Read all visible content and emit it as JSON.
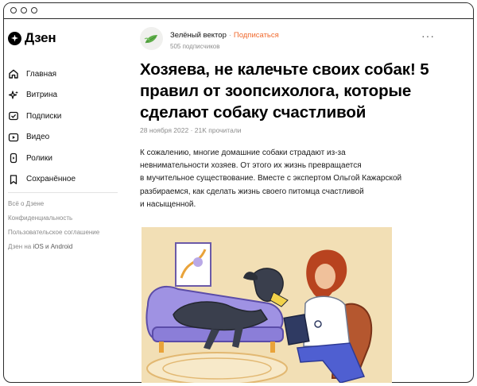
{
  "app": {
    "logo_text": "Дзен"
  },
  "sidebar": {
    "items": [
      {
        "label": "Главная",
        "icon": "home-icon"
      },
      {
        "label": "Витрина",
        "icon": "sparkle-icon"
      },
      {
        "label": "Подписки",
        "icon": "check-box-icon"
      },
      {
        "label": "Видео",
        "icon": "play-icon"
      },
      {
        "label": "Ролики",
        "icon": "shorts-icon"
      },
      {
        "label": "Сохранённое",
        "icon": "bookmark-icon"
      }
    ],
    "footer": {
      "about": "Всё о Дзене",
      "privacy": "Конфиденциальность",
      "terms": "Пользовательское соглашение",
      "apps_prefix": "Дзен на ",
      "apps_platforms": "iOS и Android"
    }
  },
  "channel": {
    "name": "Зелёный вектор",
    "separator": "·",
    "subscribe_label": "Подписаться",
    "subscribers": "505 подписчиков",
    "more_label": "···"
  },
  "article": {
    "title": "Хозяева, не калечьте своих собак! 5 правил от зоопсихолога, которые сделают собаку счастливой",
    "meta": "28 ноября 2022 · 21K прочитали",
    "lead_lines": [
      "К сожалению, многие домашние собаки страдают из-за",
      "невнимательности хозяев. От этого их жизнь превращается",
      "в мучительное существование. Вместе с экспертом Ольгой Кажарской",
      "разбираемся, как сделать жизнь своего питомца счастливой",
      "и насыщенной."
    ]
  },
  "colors": {
    "accent": "#f06a2e",
    "illustration_bg": "#f2dfb5"
  }
}
